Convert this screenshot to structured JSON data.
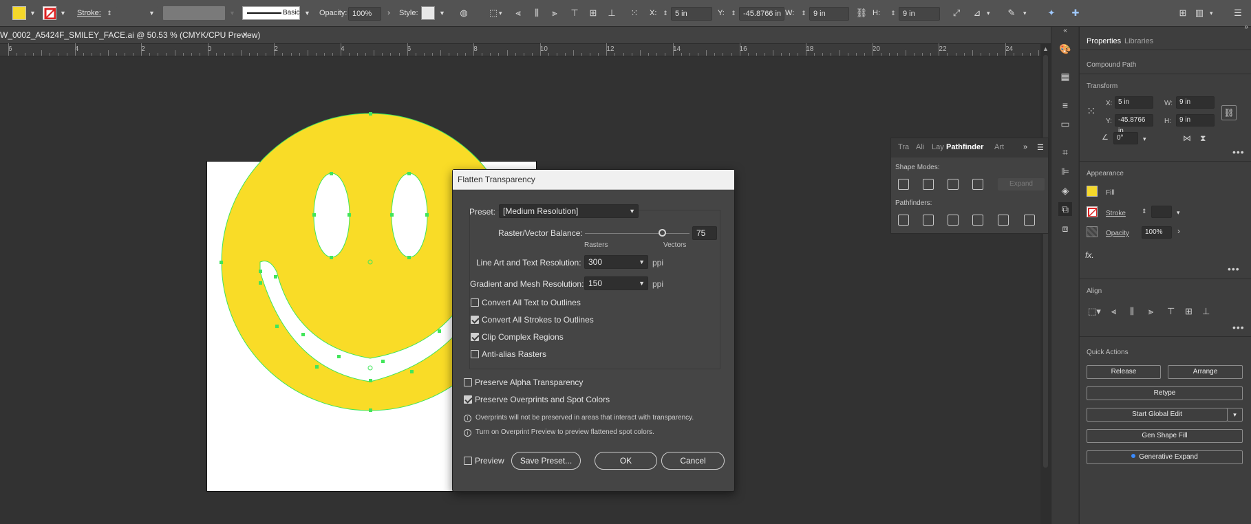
{
  "control_bar": {
    "fill_color": "#f5d82b",
    "stroke_label": "Stroke:",
    "stroke_value": "",
    "brush_label": "Basic",
    "opacity_label": "Opacity:",
    "opacity_value": "100%",
    "style_label": "Style:",
    "x_label": "X:",
    "x_value": "5 in",
    "y_label": "Y:",
    "y_value": "-45.8766 in",
    "w_label": "W:",
    "w_value": "9 in",
    "h_label": "H:",
    "h_value": "9 in"
  },
  "document": {
    "tab_title": "W_0002_A5424F_SMILEY_FACE.ai @ 50.53 % (CMYK/CPU Preview)",
    "close_glyph": "×"
  },
  "ruler": {
    "labels": [
      "6",
      "4",
      "2",
      "0",
      "2",
      "4",
      "6",
      "8",
      "10",
      "12",
      "14",
      "16",
      "18",
      "20",
      "22",
      "24"
    ]
  },
  "pathfinder_panel": {
    "tabs": [
      "Tra",
      "Ali",
      "Lay",
      "Pathfinder",
      "Art"
    ],
    "active_tab": "Pathfinder",
    "shape_modes_label": "Shape Modes:",
    "expand_label": "Expand",
    "pathfinders_label": "Pathfinders:"
  },
  "properties": {
    "tabs": [
      "Properties",
      "Libraries"
    ],
    "object_type": "Compound Path",
    "transform": {
      "title": "Transform",
      "x_label": "X:",
      "x_value": "5 in",
      "y_label": "Y:",
      "y_value": "-45.8766 in",
      "w_label": "W:",
      "w_value": "9 in",
      "h_label": "H:",
      "h_value": "9 in",
      "angle_value": "0°"
    },
    "appearance": {
      "title": "Appearance",
      "fill_label": "Fill",
      "stroke_label": "Stroke",
      "opacity_label": "Opacity",
      "opacity_value": "100%",
      "fx_label": "fx."
    },
    "align_title": "Align",
    "quick_actions": {
      "title": "Quick Actions",
      "release": "Release",
      "arrange": "Arrange",
      "retype": "Retype",
      "start_global_edit": "Start Global Edit",
      "gen_shape_fill": "Gen Shape Fill",
      "generative_expand": "Generative Expand"
    }
  },
  "dialog": {
    "title": "Flatten Transparency",
    "preset_label": "Preset:",
    "preset_value": "[Medium Resolution]",
    "balance_label": "Raster/Vector Balance:",
    "balance_value": "75",
    "balance_level": 0.75,
    "rasters_label": "Rasters",
    "vectors_label": "Vectors",
    "line_art_label": "Line Art and Text Resolution:",
    "line_art_value": "300",
    "line_art_unit": "ppi",
    "gradient_label": "Gradient and Mesh Resolution:",
    "gradient_value": "150",
    "gradient_unit": "ppi",
    "convert_text": "Convert All Text to Outlines",
    "convert_strokes": "Convert All Strokes to Outlines",
    "clip_complex": "Clip Complex Regions",
    "antialias": "Anti-alias Rasters",
    "preserve_alpha": "Preserve Alpha Transparency",
    "preserve_overprints": "Preserve Overprints and Spot Colors",
    "info1": "Overprints will not be preserved in areas that interact with transparency.",
    "info2": "Turn on Overprint Preview to preview flattened spot colors.",
    "preview_label": "Preview",
    "save_preset": "Save Preset...",
    "ok": "OK",
    "cancel": "Cancel"
  },
  "colors": {
    "smiley_yellow": "#f9dc27",
    "selection_green": "#41e65a",
    "ui_dark": "#323232"
  }
}
